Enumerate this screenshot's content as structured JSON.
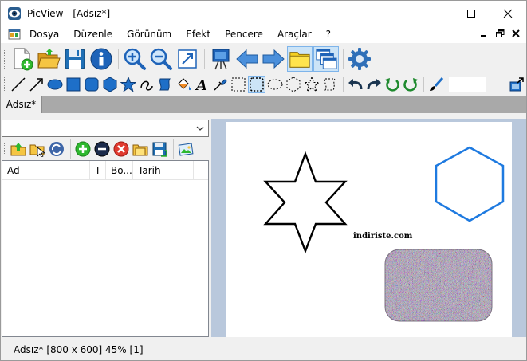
{
  "window": {
    "title": "PicView - [Adsız*]",
    "app_icon": "picview-eye-icon"
  },
  "menu": {
    "items": [
      "Dosya",
      "Düzenle",
      "Görünüm",
      "Efekt",
      "Pencere",
      "Araçlar",
      "?"
    ]
  },
  "toolbar1": {
    "icons": [
      "new-document-icon",
      "open-folder-icon",
      "save-icon",
      "info-icon",
      "zoom-in-icon",
      "zoom-out-icon",
      "crop-resize-icon",
      "slideshow-easel-icon",
      "arrow-left-icon",
      "arrow-right-icon",
      "folder-browser-icon",
      "windows-cascade-icon",
      "settings-gear-icon"
    ]
  },
  "toolbar2": {
    "icons": [
      "line-icon",
      "arrow-line-icon",
      "ellipse-icon",
      "rectangle-icon",
      "rounded-rectangle-icon",
      "hexagon-icon",
      "star-icon",
      "freehand-icon",
      "shape-fill-icon",
      "fill-bucket-icon",
      "text-tool-icon",
      "eyedropper-icon",
      "select-rectangle-icon",
      "select-rounded-icon",
      "select-ellipse-icon",
      "select-hexagon-icon",
      "select-star-icon",
      "select-freeform-icon",
      "undo-icon",
      "redo-icon",
      "rotate-left-icon",
      "rotate-right-icon",
      "brush-icon",
      "export-image-icon"
    ]
  },
  "tabs": [
    {
      "label": "Adsız*",
      "active": true
    }
  ],
  "left_panel": {
    "path_value": "",
    "tools": [
      "folder-up-icon",
      "select-folder-icon",
      "refresh-icon",
      "add-icon",
      "remove-icon",
      "delete-icon",
      "new-folder-icon",
      "save-list-icon",
      "preview-image-icon"
    ],
    "columns": [
      "Ad",
      "T",
      "Bo...",
      "Tarih"
    ]
  },
  "canvas": {
    "watermark": "indiriste.com",
    "colors": {
      "guide": "#5b9bd5",
      "hexagon": "#1e7ae0",
      "star": "#000000",
      "noise_base": "#8a8090"
    }
  },
  "status": {
    "text": "Adsız* [800 x 600] 45% [1]"
  }
}
